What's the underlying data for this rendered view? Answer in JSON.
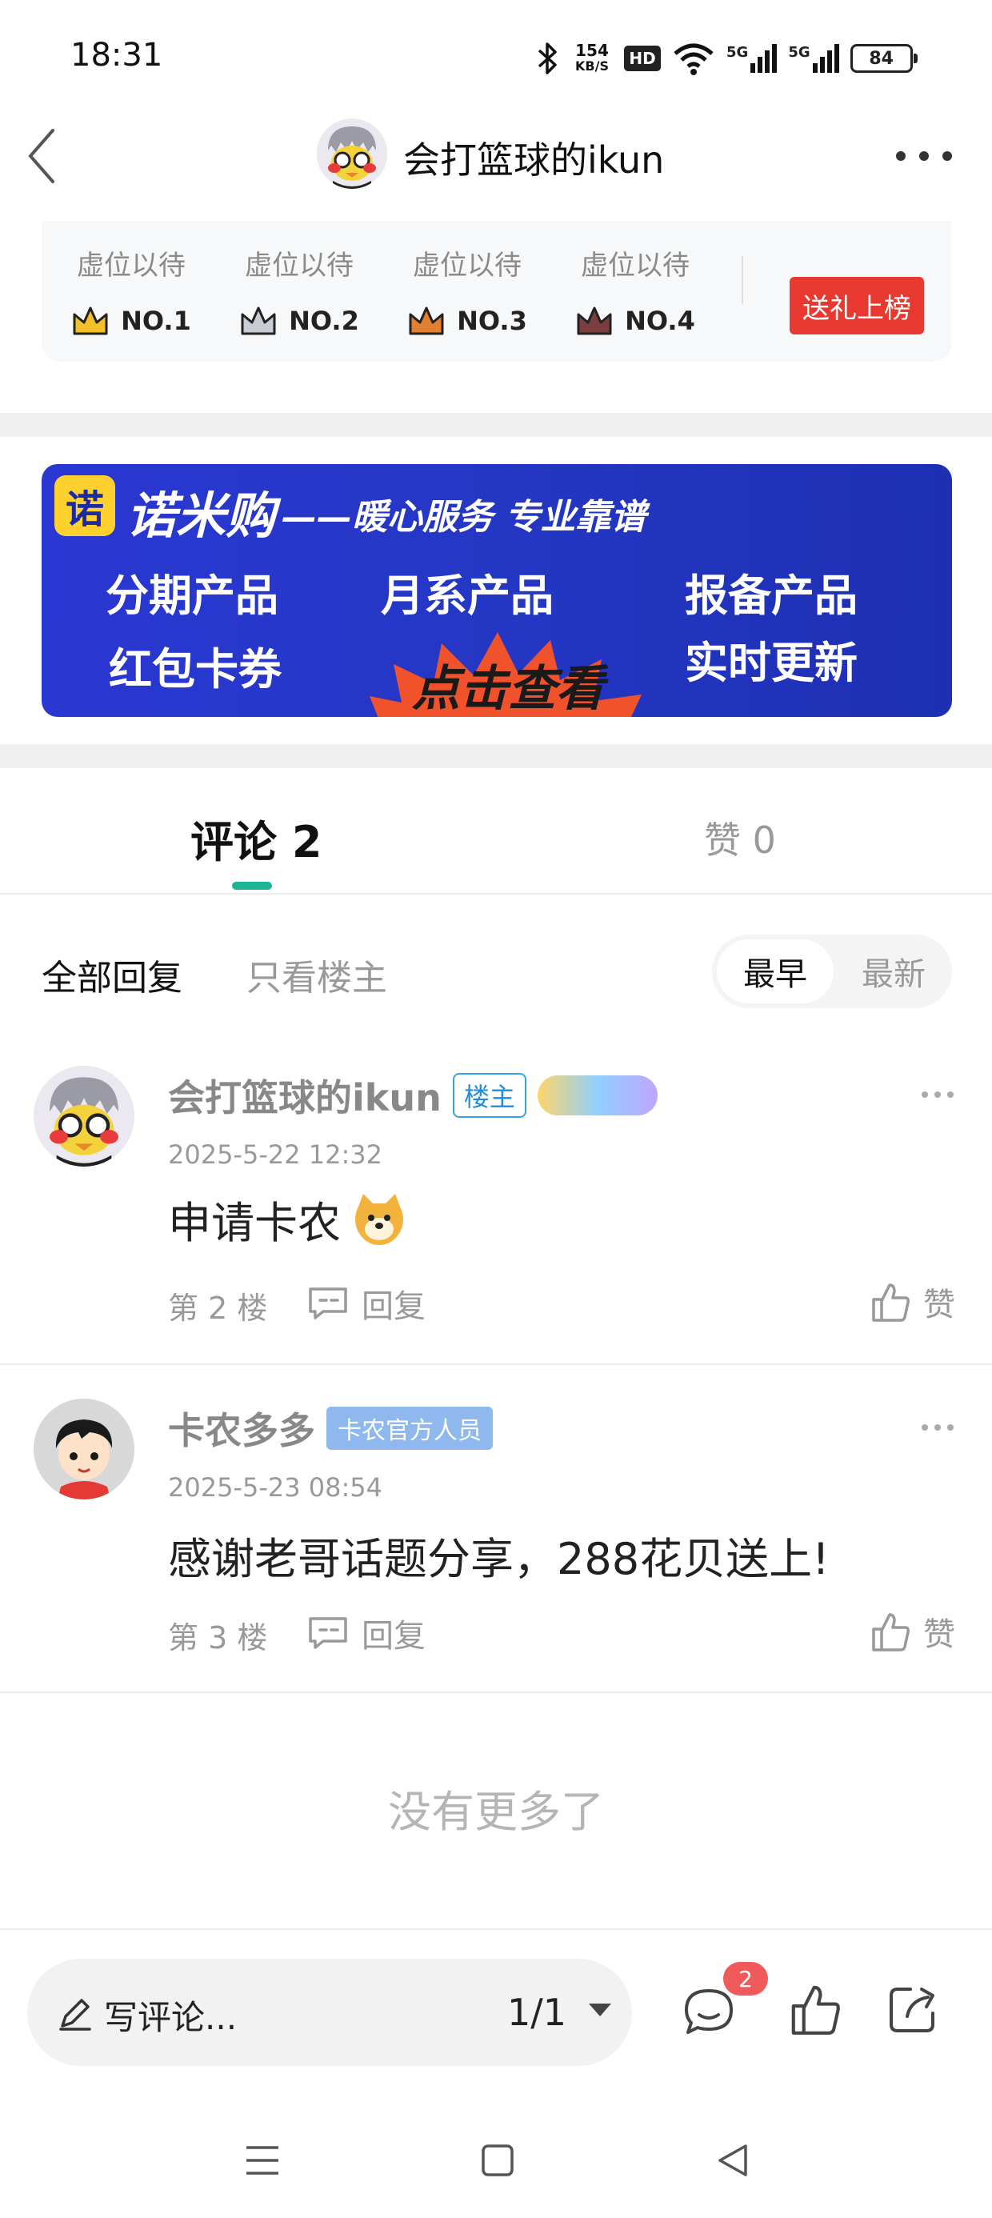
{
  "status_bar": {
    "time": "18:31",
    "net_speed_value": "154",
    "net_speed_unit": "KB/S",
    "hd_label": "HD",
    "signal1_label": "5G",
    "signal2_label": "5G",
    "battery": "84"
  },
  "header": {
    "title": "会打篮球的ikun"
  },
  "gift_rank": {
    "slots": [
      {
        "waiting": "虚位以待",
        "rank": "NO.1",
        "crown_color": "#e8b21c"
      },
      {
        "waiting": "虚位以待",
        "rank": "NO.2",
        "crown_color": "#b9bcc6"
      },
      {
        "waiting": "虚位以待",
        "rank": "NO.3",
        "crown_color": "#d9772a"
      },
      {
        "waiting": "虚位以待",
        "rank": "NO.4",
        "crown_color": "#6b3a3a"
      }
    ],
    "gift_button": "送礼上榜"
  },
  "banner": {
    "logo_char": "诺",
    "brand": "诺米购",
    "slogan": "——暖心服务 专业靠谱",
    "item1": "分期产品",
    "item2": "月系产品",
    "item3": "报备产品",
    "item4": "红包卡券",
    "item5": "实时更新",
    "cta": "点击查看"
  },
  "tabs": {
    "comments_label": "评论",
    "comments_count": "2",
    "likes_label": "赞",
    "likes_count": "0"
  },
  "filter": {
    "all": "全部回复",
    "op_only": "只看楼主",
    "sort_earliest": "最早",
    "sort_latest": "最新"
  },
  "comments": [
    {
      "name": "会打篮球的ikun",
      "badge": "楼主",
      "time": "2025-5-22 12:32",
      "text": "申请卡农",
      "floor": "第 2 楼",
      "reply": "回复",
      "like": "赞"
    },
    {
      "name": "卡农多多",
      "badge": "卡农官方人员",
      "time": "2025-5-23 08:54",
      "text": "感谢老哥话题分享，288花贝送上!",
      "floor": "第 3 楼",
      "reply": "回复",
      "like": "赞"
    }
  ],
  "no_more": "没有更多了",
  "bottom_bar": {
    "write_placeholder": "写评论...",
    "page_indicator": "1/1",
    "comment_badge": "2"
  },
  "colors": {
    "accent_green": "#1db395",
    "gift_red": "#e8382f",
    "banner_blue": "#2437c4",
    "badge_red": "#f05a5a"
  }
}
